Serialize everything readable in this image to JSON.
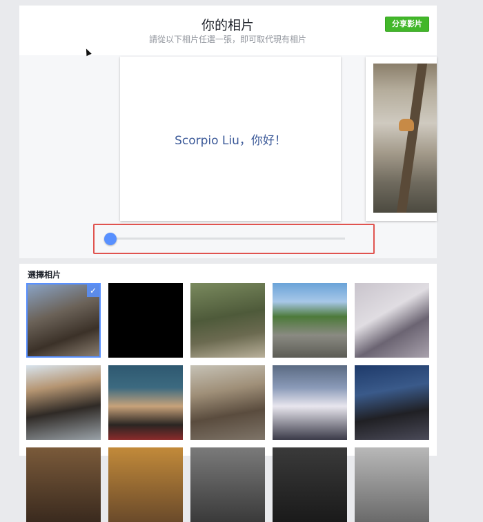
{
  "header": {
    "title": "你的相片",
    "subtitle": "請從以下相片任選一張，即可取代現有相片",
    "share_label": "分享影片"
  },
  "carousel": {
    "greeting": "Scorpio Liu，你好！"
  },
  "slider": {
    "value": 0
  },
  "photos": {
    "section_label": "選擇相片",
    "selected_index": 0,
    "check_glyph": "✓",
    "items": [
      {
        "bg": "linear-gradient(160deg,#8aa3c4 0%,#6b6258 40%,#3b3128 70%,#8a7e70 100%)"
      },
      {
        "bg": "#000000"
      },
      {
        "bg": "linear-gradient(170deg,#7a8a5e 0%,#4e5a3a 45%,#6b6a50 70%,#b9b09a 100%)"
      },
      {
        "bg": "linear-gradient(180deg,#6aa3d8 0%,#a7c7e8 25%,#4d7a3a 45%,#8a8a82 70%,#5c5c55 100%)"
      },
      {
        "bg": "linear-gradient(150deg,#c9c4cc 0%,#e0dde2 40%,#6b6472 65%,#a9a2ad 100%)"
      },
      {
        "bg": "linear-gradient(170deg,#d8e4ee 0%,#b59572 30%,#2f2a26 60%,#9aa2a8 100%)"
      },
      {
        "bg": "linear-gradient(180deg,#2e5870 0%,#3c6a80 30%,#c7a27a 55%,#2a2522 80%,#8a2b2b 100%)"
      },
      {
        "bg": "linear-gradient(170deg,#c6c2b6 0%,#9f8f78 35%,#5a4c3e 65%,#7e7468 100%)"
      },
      {
        "bg": "linear-gradient(180deg,#5a6a82 0%,#8a9ab8 30%,#e8e6ee 55%,#3a3a48 100%)"
      },
      {
        "bg": "linear-gradient(170deg,#1e3a6a 0%,#3a5a8a 35%,#202024 65%,#4a4a58 100%)"
      },
      {
        "bg": "linear-gradient(180deg,#7a5a3a 0%,#3a2a1e 100%)"
      },
      {
        "bg": "linear-gradient(180deg,#c28a3a 0%,#6a4a2a 100%)"
      },
      {
        "bg": "linear-gradient(180deg,#7a7a7a 0%,#3a3a3a 100%)"
      },
      {
        "bg": "linear-gradient(180deg,#3a3a3a 0%,#1a1a1a 100%)"
      },
      {
        "bg": "linear-gradient(180deg,#b8b8b8 0%,#6a6a6a 100%)"
      }
    ]
  }
}
